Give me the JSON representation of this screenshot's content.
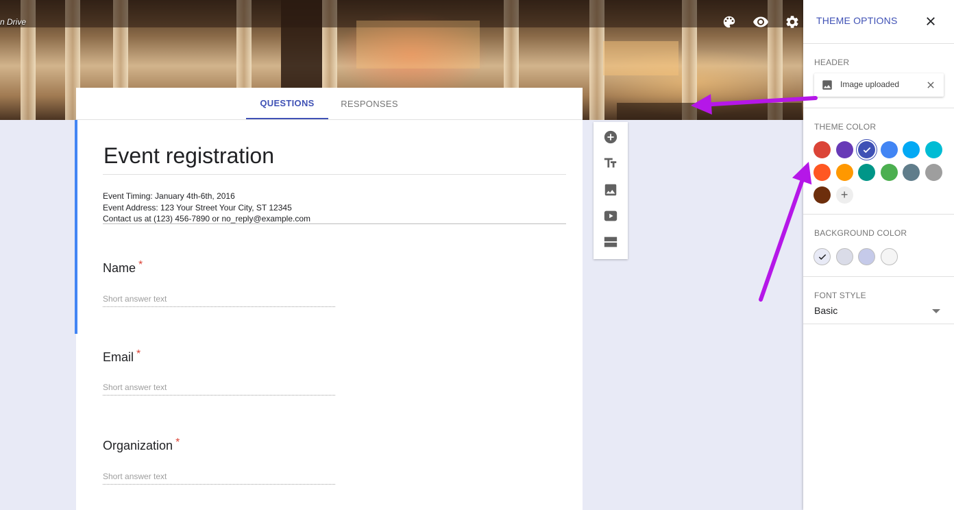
{
  "header": {
    "drive_text": "n Drive",
    "icons": [
      "palette-icon",
      "eye-icon",
      "gear-icon"
    ]
  },
  "tabs": [
    {
      "label": "QUESTIONS",
      "active": true
    },
    {
      "label": "RESPONSES",
      "active": false
    }
  ],
  "form": {
    "title": "Event registration",
    "description_lines": [
      "Event Timing: January 4th-6th, 2016",
      "Event Address: 123 Your Street Your City, ST 12345",
      "Contact us at (123) 456-7890 or no_reply@example.com"
    ],
    "required_mark": "*",
    "questions": [
      {
        "label": "Name",
        "placeholder": "Short answer text"
      },
      {
        "label": "Email",
        "placeholder": "Short answer text"
      },
      {
        "label": "Organization",
        "placeholder": "Short answer text"
      }
    ]
  },
  "toolbar": {
    "icons": [
      "add-question-icon",
      "title-text-icon",
      "image-icon",
      "video-icon",
      "section-icon"
    ]
  },
  "theme_panel": {
    "title": "THEME OPTIONS",
    "header_label": "HEADER",
    "header_image_text": "Image uploaded",
    "theme_color_label": "THEME COLOR",
    "theme_colors": [
      "#db4437",
      "#673ab7",
      "#3f51b5",
      "#4285f4",
      "#03a9f4",
      "#00bcd4",
      "#ff5722",
      "#ff9800",
      "#009688",
      "#4caf50",
      "#607d8b",
      "#9e9e9e",
      "#6d2e0c"
    ],
    "selected_theme_color": "#3f51b5",
    "add_color_symbol": "+",
    "background_color_label": "BACKGROUND COLOR",
    "background_colors": [
      "#e8eaf6",
      "#dadce8",
      "#c5cae9",
      "#f5f5f5"
    ],
    "selected_background_color": "#e8eaf6",
    "font_style_label": "FONT STYLE",
    "font_style_value": "Basic"
  },
  "annotations": {
    "arrow_color": "#b517e8"
  }
}
